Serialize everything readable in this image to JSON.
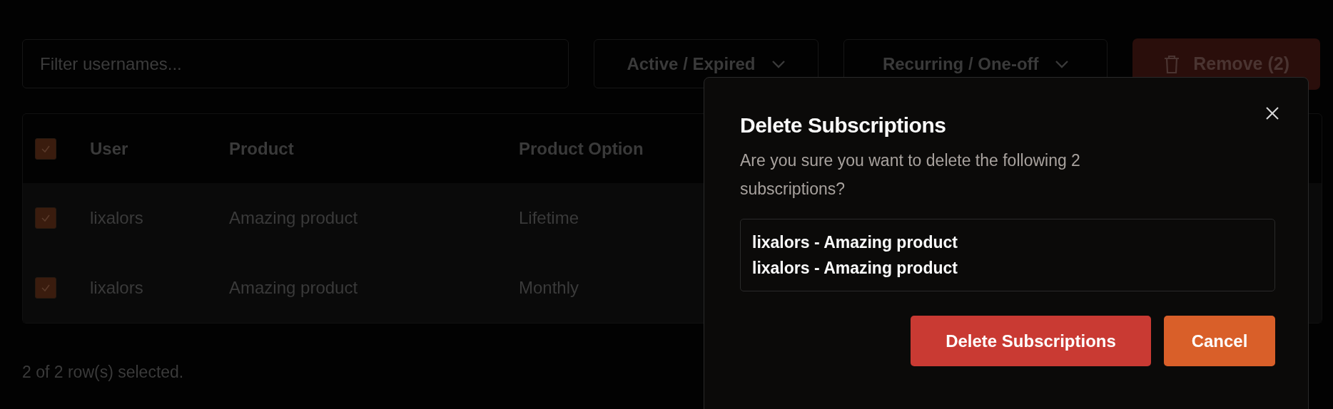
{
  "filter": {
    "placeholder": "Filter usernames..."
  },
  "dropdowns": [
    {
      "label": "Active / Expired"
    },
    {
      "label": "Recurring / One-off"
    }
  ],
  "remove_button": {
    "label": "Remove (2)"
  },
  "table": {
    "all_checked": true,
    "columns": [
      "User",
      "Product",
      "Product Option"
    ],
    "rows": [
      {
        "checked": true,
        "cells": [
          "lixalors",
          "Amazing product",
          "Lifetime"
        ]
      },
      {
        "checked": true,
        "cells": [
          "lixalors",
          "Amazing product",
          "Monthly"
        ]
      }
    ]
  },
  "footer": "2 of 2 row(s) selected.",
  "dialog": {
    "title": "Delete Subscriptions",
    "message": "Are you sure you want to delete the following 2 subscriptions?",
    "items": [
      "lixalors - Amazing product",
      "lixalors - Amazing product"
    ],
    "buttons": [
      {
        "label": "Delete Subscriptions",
        "kind": "danger"
      },
      {
        "label": "Cancel",
        "kind": "secondary"
      }
    ]
  }
}
